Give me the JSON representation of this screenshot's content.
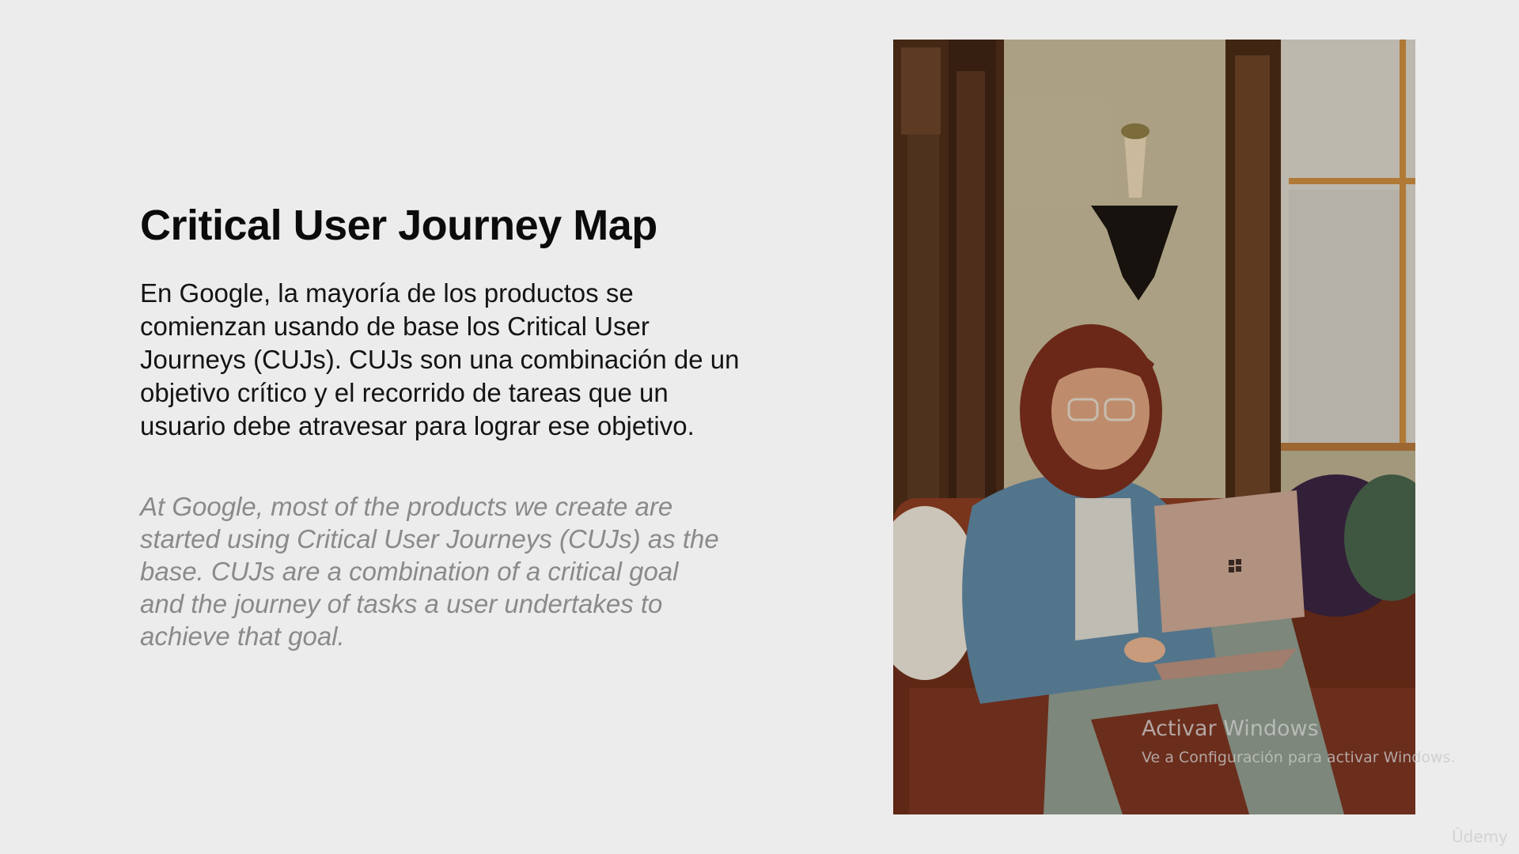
{
  "slide": {
    "title": "Critical User Journey Map",
    "body_es": "En Google, la mayoría de los productos se comienzan usando de base los Critical User Journeys (CUJs). CUJs son una combinación de un objetivo crítico y el recorrido de tareas que un usuario debe atravesar para lograr ese objetivo.",
    "body_en": "At Google, most of the products we create are started using Critical User Journeys (CUJs) as the base. CUJs are a combination of a critical goal and the journey of tasks a user undertakes to achieve that goal."
  },
  "watermark": {
    "title": "Activar Windows",
    "subtitle": "Ve a Configuración para activar Windows."
  },
  "brand": "Ûdemy"
}
